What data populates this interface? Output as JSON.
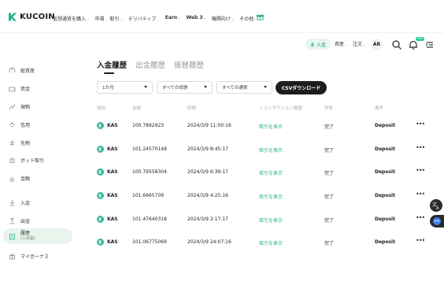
{
  "header": {
    "logo_text": "KUCOIN",
    "nav": [
      {
        "label": "仮想通貨を購入",
        "has_menu": true,
        "bold": false
      },
      {
        "label": "市場",
        "has_menu": false,
        "bold": false
      },
      {
        "label": "取引",
        "has_menu": true,
        "bold": false
      },
      {
        "label": "デリバティブ",
        "has_menu": true,
        "bold": false
      },
      {
        "label": "Earn",
        "has_menu": true,
        "bold": true
      },
      {
        "label": "Web 3",
        "has_menu": true,
        "bold": true
      },
      {
        "label": "機関向け",
        "has_menu": true,
        "bold": false
      },
      {
        "label": "その他",
        "has_menu": true,
        "bold": false
      }
    ],
    "deposit_label": "入金",
    "assets_label": "資産",
    "orders_label": "注文",
    "avatar_initials": "AR",
    "notif_badge": "99+"
  },
  "sidebar": {
    "items": [
      {
        "label": "総資産",
        "sub": ""
      },
      {
        "label": "資金",
        "sub": ""
      },
      {
        "label": "現物",
        "sub": ""
      },
      {
        "label": "信用",
        "sub": ""
      },
      {
        "label": "先物",
        "sub": ""
      },
      {
        "label": "ボット取引",
        "sub": ""
      },
      {
        "label": "金融",
        "sub": ""
      },
      {
        "label": "入金",
        "sub": ""
      },
      {
        "label": "出金",
        "sub": ""
      },
      {
        "label": "履歴",
        "sub": "(入出金)"
      },
      {
        "label": "マイボーナス",
        "sub": ""
      }
    ],
    "active_index": 9
  },
  "tabs": [
    "入金履歴",
    "出金履歴",
    "振替履歴"
  ],
  "filters": {
    "period": "1か月",
    "status": "すべての状態",
    "currency": "すべての通貨",
    "csv_label": "CSVダウンロード"
  },
  "table": {
    "headers": [
      "銘柄",
      "金額",
      "時間",
      "トランザクション履歴",
      "状態",
      "備考"
    ],
    "rows": [
      {
        "coin": "KAS",
        "amount": "100.7892923",
        "time": "2024/3/9 11:00:16",
        "link": "取引を表示",
        "status": "完了",
        "note": "Deposit"
      },
      {
        "coin": "KAS",
        "amount": "101.24570148",
        "time": "2024/3/9 8:45:17",
        "link": "取引を表示",
        "status": "完了",
        "note": "Deposit"
      },
      {
        "coin": "KAS",
        "amount": "100.79558304",
        "time": "2024/3/9 6:39:17",
        "link": "取引を表示",
        "status": "完了",
        "note": "Deposit"
      },
      {
        "coin": "KAS",
        "amount": "101.6665709",
        "time": "2024/3/9 4:25:16",
        "link": "取引を表示",
        "status": "完了",
        "note": "Deposit"
      },
      {
        "coin": "KAS",
        "amount": "101.47640318",
        "time": "2024/3/9 2:17:17",
        "link": "取引を表示",
        "status": "完了",
        "note": "Deposit"
      },
      {
        "coin": "KAS",
        "amount": "101.06775069",
        "time": "2024/3/9 24:07:16",
        "link": "取引を表示",
        "status": "完了",
        "note": "Deposit"
      }
    ]
  },
  "colors": {
    "accent": "#24ae8f",
    "dark": "#1d1d1d",
    "active_bg": "#e8f4ec"
  }
}
